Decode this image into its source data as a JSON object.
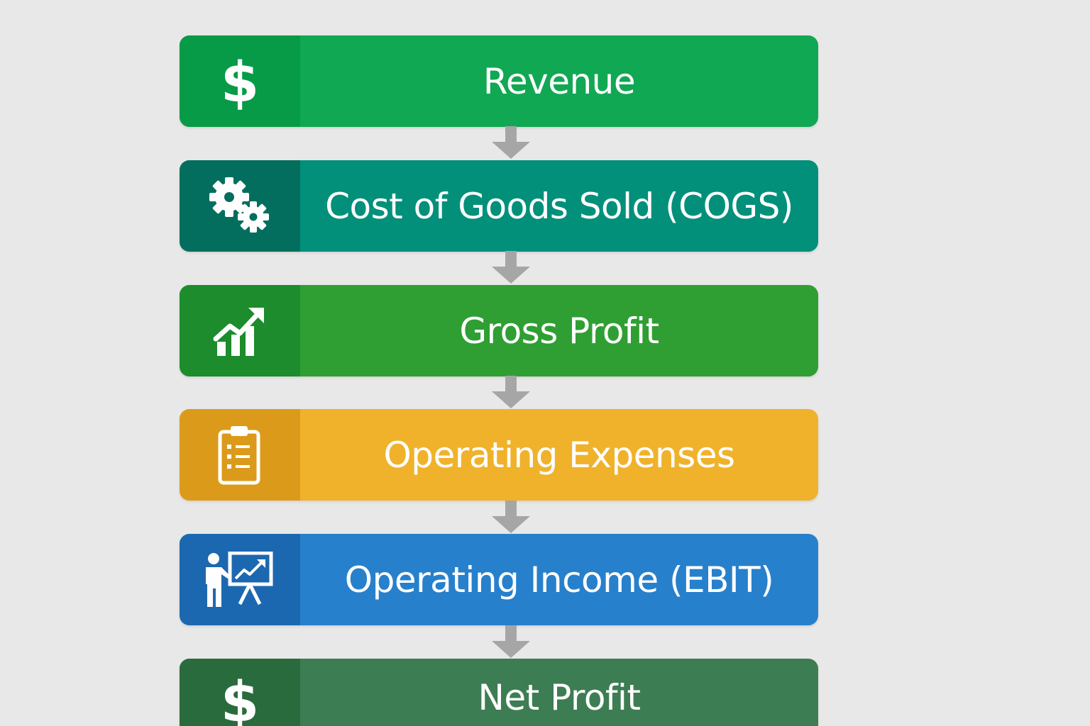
{
  "flow": {
    "steps": [
      {
        "label": "Revenue",
        "icon": "dollar-icon",
        "color": "#10a853",
        "icon_bg": "#079b47"
      },
      {
        "label": "Cost of Goods Sold (COGS)",
        "icon": "gears-icon",
        "color": "#03907b",
        "icon_bg": "#046e5e"
      },
      {
        "label": "Gross Profit",
        "icon": "growth-chart-icon",
        "color": "#2f9f33",
        "icon_bg": "#1c8c2c"
      },
      {
        "label": "Operating Expenses",
        "icon": "clipboard-checklist-icon",
        "color": "#f0b22b",
        "icon_bg": "#dc9a1b"
      },
      {
        "label": "Operating Income (EBIT)",
        "icon": "presenter-chart-icon",
        "color": "#2780cc",
        "icon_bg": "#1c68b0"
      },
      {
        "label": "Net Profit",
        "icon": "dollar-icon",
        "color": "#3d7d53",
        "icon_bg": "#2a6b3d"
      }
    ],
    "arrow_color": "#a6a6a6"
  }
}
